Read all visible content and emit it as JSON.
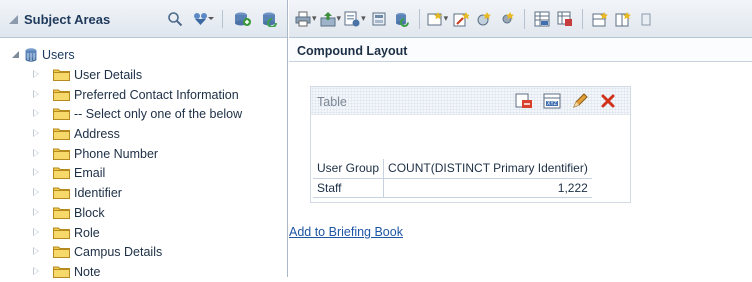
{
  "subject_areas": {
    "title": "Subject Areas",
    "header_icons": [
      "search-icon",
      "filter-icon",
      "add-subject-area-icon",
      "refresh-icon"
    ],
    "root": {
      "label": "Users",
      "icon": "database-icon"
    },
    "items": [
      {
        "label": "User Details"
      },
      {
        "label": "Preferred Contact Information"
      },
      {
        "label": "-- Select only one of the below"
      },
      {
        "label": "Address"
      },
      {
        "label": "Phone Number"
      },
      {
        "label": "Email"
      },
      {
        "label": "Identifier"
      },
      {
        "label": "Block"
      },
      {
        "label": "Role"
      },
      {
        "label": "Campus Details"
      },
      {
        "label": "Note"
      }
    ]
  },
  "toolbar": {
    "icons": [
      "print-icon",
      "export-icon",
      "page-options-icon",
      "show-hide-icon",
      "refresh-icon",
      "new-view-icon",
      "edit-view-icon",
      "manage-views-icon",
      "settings-icon",
      "table-view-icon",
      "pivot-view-icon",
      "new-row-icon",
      "new-column-icon",
      "more-icon"
    ]
  },
  "compound": {
    "title": "Compound Layout"
  },
  "view": {
    "title": "Table",
    "icons": [
      "remove-view-icon",
      "format-view-icon",
      "edit-pencil-icon",
      "delete-x-icon"
    ]
  },
  "table": {
    "headers": [
      "User Group",
      "COUNT(DISTINCT Primary Identifier)"
    ],
    "rows": [
      [
        "Staff",
        "1,222"
      ]
    ]
  },
  "briefing_link": "Add to Briefing Book",
  "colors": {
    "accent": "#1f55a5",
    "folder": "#f2c94c",
    "header_bg": "#e6ecf2"
  }
}
